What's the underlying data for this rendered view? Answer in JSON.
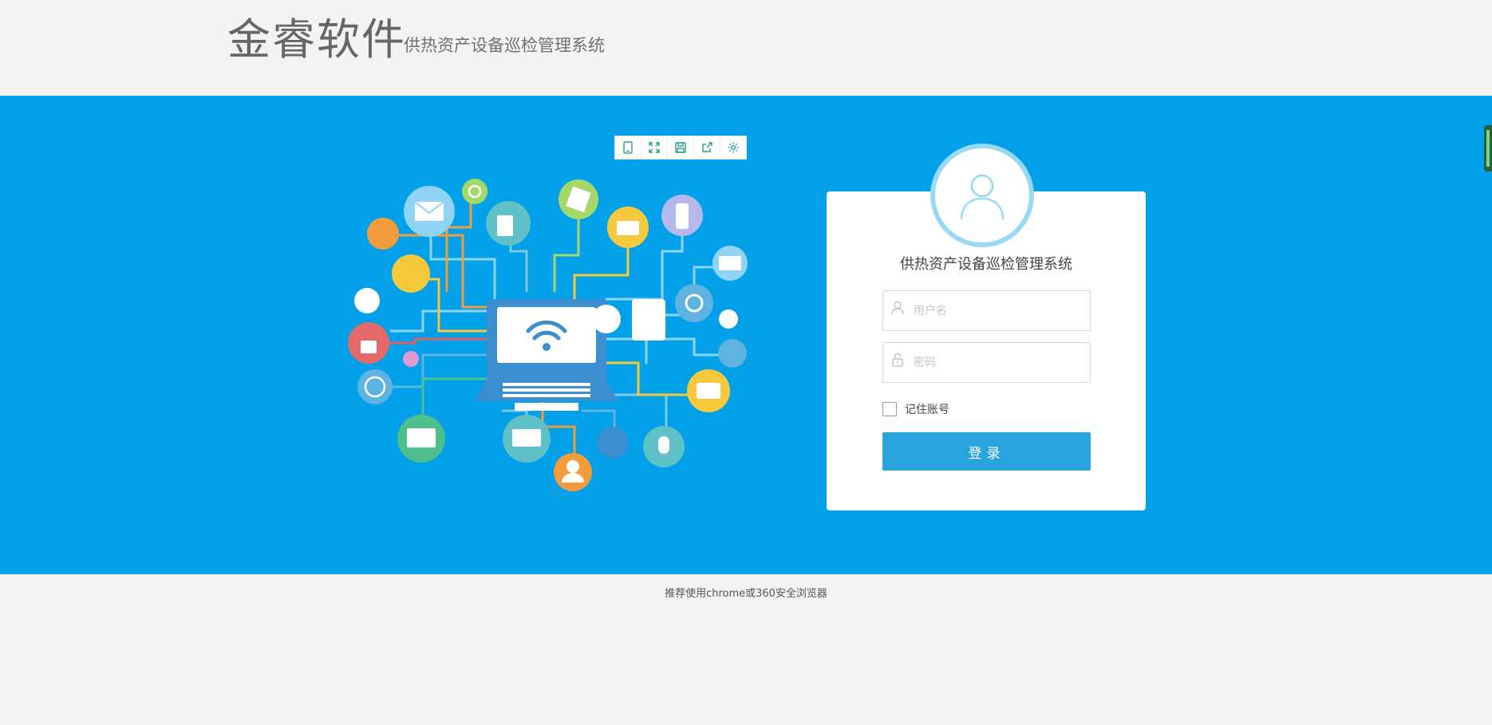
{
  "header": {
    "brand": "金睿软件",
    "system_title": "供热资产设备巡检管理系统"
  },
  "toolbar": {
    "icons": [
      "tablet-icon",
      "expand-icon",
      "save-icon",
      "share-icon",
      "gear-icon"
    ]
  },
  "login": {
    "title": "供热资产设备巡检管理系统",
    "username_placeholder": "用户名",
    "password_placeholder": "密码",
    "remember_label": "记住账号",
    "submit_label": "登录"
  },
  "footer": {
    "note": "推荐使用chrome或360安全浏览器"
  },
  "colors": {
    "banner": "#02a0e9",
    "button": "#29a4dc",
    "avatar_ring": "#9ad9f4"
  }
}
